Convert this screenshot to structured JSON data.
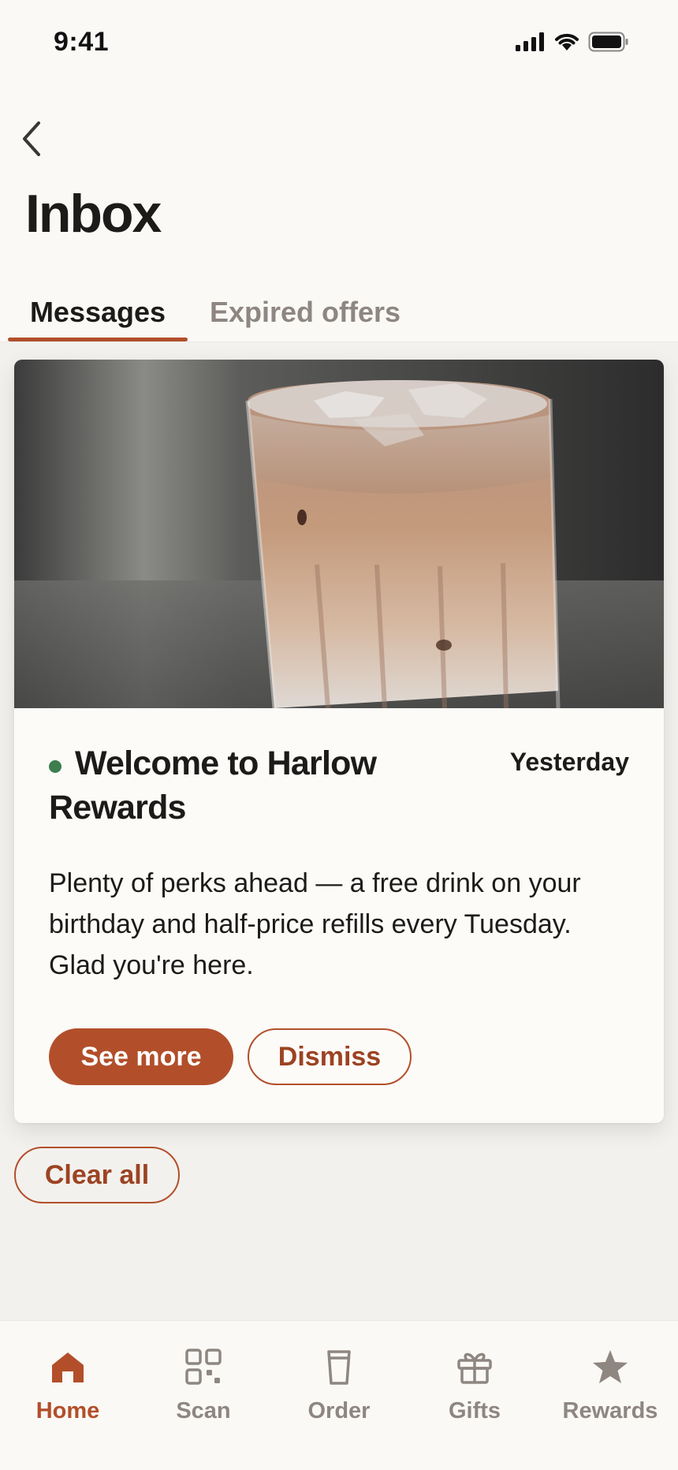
{
  "status_bar": {
    "time": "9:41",
    "icons": [
      "signal-icon",
      "wifi-icon",
      "battery-icon"
    ]
  },
  "header": {
    "back_icon": "chevron-left-icon",
    "title": "Inbox"
  },
  "tabs": [
    {
      "label": "Messages",
      "active": true
    },
    {
      "label": "Expired offers",
      "active": false
    }
  ],
  "message": {
    "image": "iced-latte-photo",
    "unread": true,
    "title": "Welcome to Harlow Rewards",
    "date": "Yesterday",
    "body": "Plenty of perks ahead — a free drink on your birthday and half-price refills every Tuesday. Glad you're here.",
    "primary_action": "See more",
    "secondary_action": "Dismiss"
  },
  "clear_all_label": "Clear all",
  "bottom_nav": [
    {
      "label": "Home",
      "icon": "home-icon",
      "active": true
    },
    {
      "label": "Scan",
      "icon": "scan-icon",
      "active": false
    },
    {
      "label": "Order",
      "icon": "cup-icon",
      "active": false
    },
    {
      "label": "Gifts",
      "icon": "gift-icon",
      "active": false
    },
    {
      "label": "Rewards",
      "icon": "star-icon",
      "active": false
    }
  ],
  "colors": {
    "accent": "#b24f2a",
    "unread_dot": "#3d7d4f",
    "inactive_text": "#8e8680",
    "background": "#f3f1ee"
  }
}
